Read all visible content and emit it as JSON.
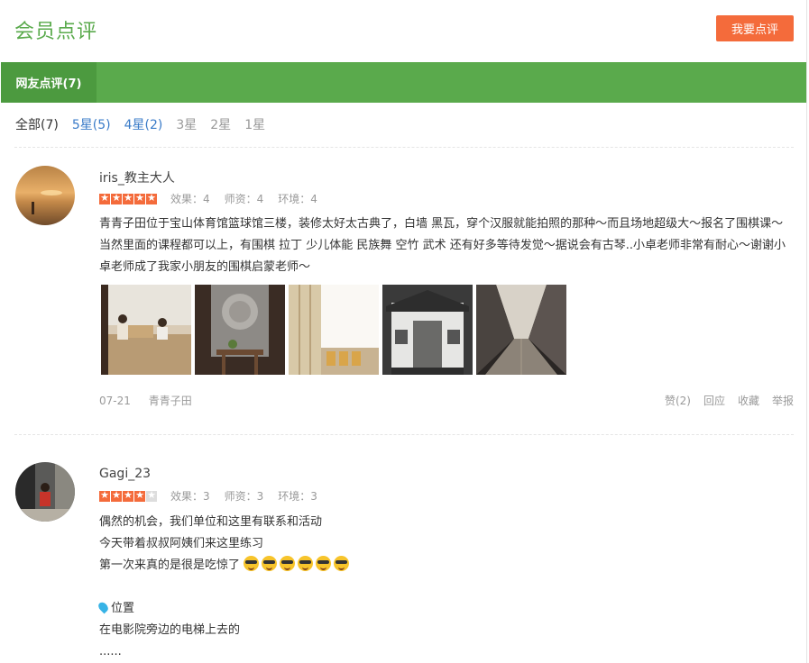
{
  "header": {
    "title": "会员点评",
    "write_button": "我要点评"
  },
  "tabs": [
    {
      "label": "网友点评(7)",
      "active": true
    }
  ],
  "filters": [
    {
      "label": "全部(7)",
      "style": "all"
    },
    {
      "label": "5星(5)",
      "style": "blue"
    },
    {
      "label": "4星(2)",
      "style": "blue"
    },
    {
      "label": "3星",
      "style": "gray"
    },
    {
      "label": "2星",
      "style": "gray"
    },
    {
      "label": "1星",
      "style": "gray"
    }
  ],
  "reviews": [
    {
      "user": "iris_教主大人",
      "stars": 5,
      "scores": {
        "effect": "效果：4",
        "teacher": "师资：4",
        "env": "环境：4"
      },
      "text": "青青子田位于宝山体育馆篮球馆三楼，装修太好太古典了，白墙 黑瓦，穿个汉服就能拍照的那种～而且场地超级大～报名了围棋课～ 当然里面的课程都可以上，有围棋 拉丁 少儿体能 民族舞 空竹 武术 还有好多等待发觉～据说会有古琴..小卓老师非常有耐心～谢谢小卓老师成了我家小朋友的围棋启蒙老师～",
      "date": "07-21",
      "shop": "青青子田",
      "actions": {
        "like": "赞(2)",
        "reply": "回应",
        "fav": "收藏",
        "report": "举报"
      }
    },
    {
      "user": "Gagi_23",
      "stars": 4,
      "scores": {
        "effect": "效果：3",
        "teacher": "师资：3",
        "env": "环境：3"
      },
      "lines": [
        "偶然的机会，我们单位和这里有联系和活动",
        "今天带着叔叔阿姨们来这里练习",
        "第一次来真的是很是吃惊了"
      ],
      "location_label": "位置",
      "location_text": "在电影院旁边的电梯上去的",
      "ellipsis": "......"
    }
  ]
}
